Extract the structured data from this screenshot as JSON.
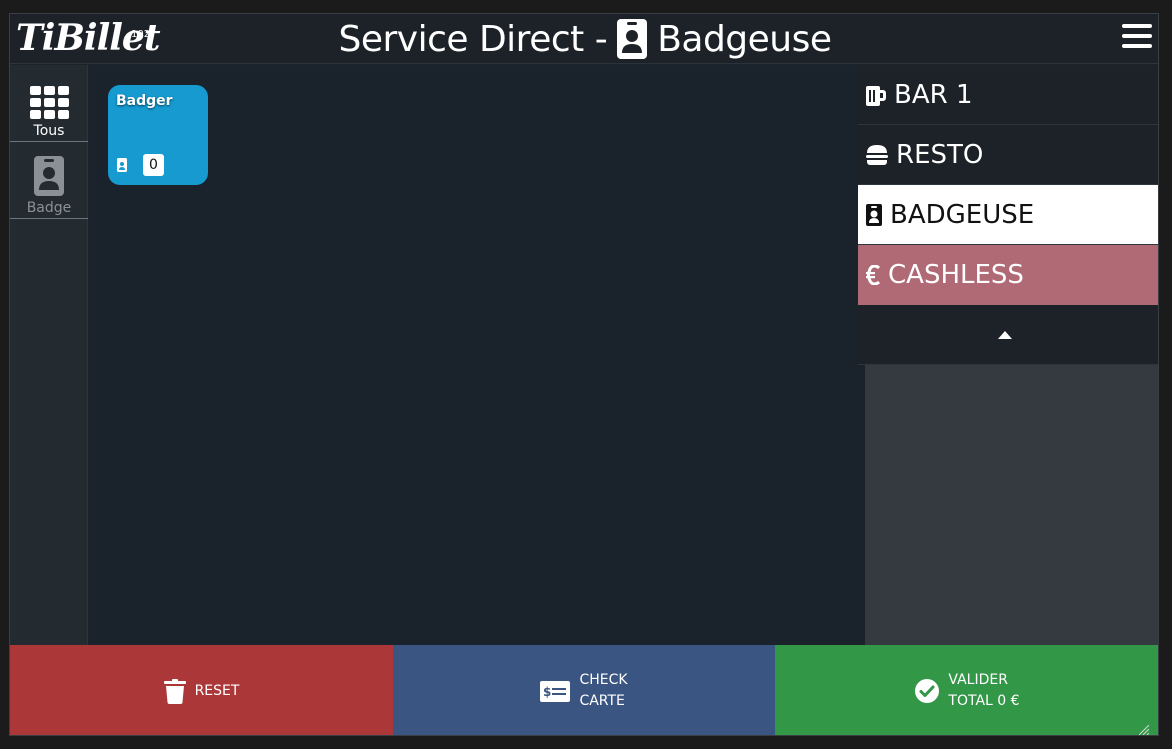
{
  "header": {
    "logo": "TiBillet",
    "logo_sup": "102",
    "title_left": "Service Direct -",
    "title_right": "Badgeuse"
  },
  "sidebar": {
    "items": [
      {
        "label": "Tous",
        "icon": "grid-icon"
      },
      {
        "label": "Badge",
        "icon": "badge-icon"
      }
    ]
  },
  "main": {
    "cards": [
      {
        "name": "Badger",
        "icon": "badge-icon",
        "qty": "0",
        "color": "#169ad0"
      }
    ]
  },
  "menu": {
    "items": [
      {
        "label": "BAR 1",
        "icon": "beer-icon"
      },
      {
        "label": "RESTO",
        "icon": "burger-icon"
      },
      {
        "label": "BADGEUSE",
        "icon": "badge-icon"
      },
      {
        "label": "CASHLESS",
        "icon": "euro-icon"
      }
    ],
    "toggle_icon": "caret-up-icon"
  },
  "footer": {
    "reset": "RESET",
    "check_line1": "CHECK",
    "check_line2": "CARTE",
    "valid_line1": "VALIDER",
    "valid_line2": "TOTAL 0 €"
  },
  "colors": {
    "reset": "#ac3739",
    "check": "#3b5582",
    "valid": "#339748",
    "cashless": "#b06a75",
    "card": "#169ad0"
  }
}
